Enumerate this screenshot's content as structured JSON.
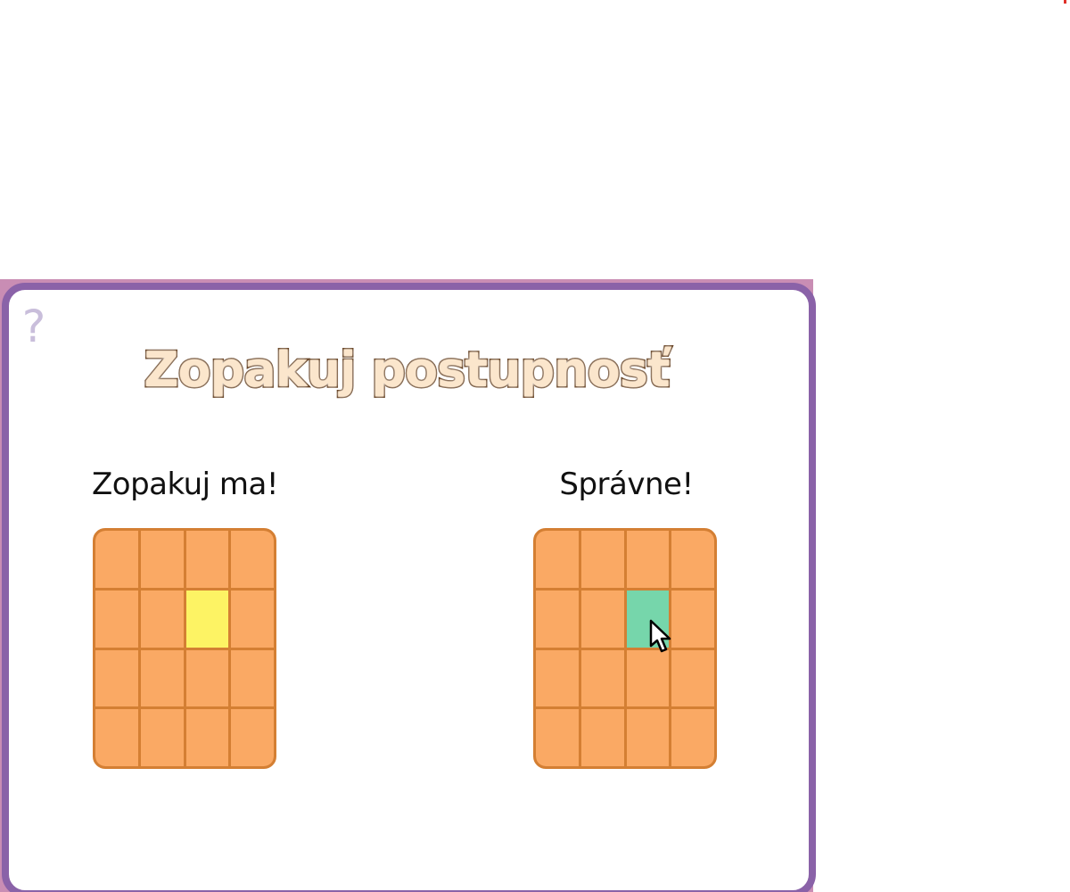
{
  "game": {
    "title": "Zopakuj postupnosť",
    "help_symbol": "?",
    "left_label": "Zopakuj ma!",
    "right_label": "Správne!"
  },
  "grids": {
    "rows": 4,
    "cols": 4,
    "left_highlight": {
      "row": 2,
      "col": 3,
      "color": "#fdf364"
    },
    "right_highlight": {
      "row": 2,
      "col": 3,
      "color": "#76d6ab"
    }
  },
  "colors": {
    "panel_border": "#8a62a8",
    "tile": "#faa964",
    "tile_border": "#d47f33",
    "title_fill": "#fbe6cc",
    "title_stroke": "#5a3413",
    "help_icon": "#c9bedb"
  },
  "icons": {
    "help": "question-mark-icon",
    "cursor": "mouse-pointer-icon"
  }
}
